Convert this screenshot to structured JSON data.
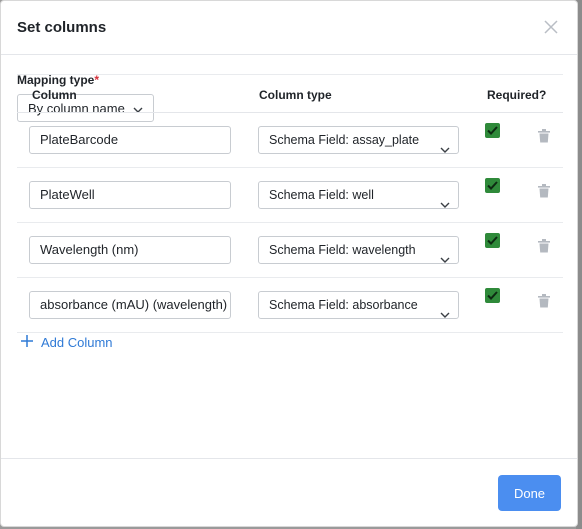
{
  "dialog": {
    "title": "Set columns",
    "mapping_label": "Mapping type",
    "required_mark": "*",
    "mapping_value": "By column name"
  },
  "table": {
    "headers": {
      "column": "Column",
      "type": "Column type",
      "required": "Required?"
    },
    "rows": [
      {
        "column": "PlateBarcode",
        "type": "Schema Field: assay_plate",
        "required": true
      },
      {
        "column": "PlateWell",
        "type": "Schema Field: well",
        "required": true
      },
      {
        "column": "Wavelength (nm)",
        "type": "Schema Field: wavelength",
        "required": true
      },
      {
        "column": "absorbance (mAU) (wavelength)",
        "type": "Schema Field: absorbance",
        "required": true
      }
    ]
  },
  "add_column_label": "Add Column",
  "done_label": "Done",
  "colors": {
    "primary": "#4b8ef0",
    "link": "#2f7ad6",
    "checkbox": "#2f8a3a",
    "required": "#d4303a"
  },
  "icons": [
    "close-icon",
    "chevron-down-icon",
    "check-icon",
    "trash-icon",
    "plus-icon"
  ]
}
